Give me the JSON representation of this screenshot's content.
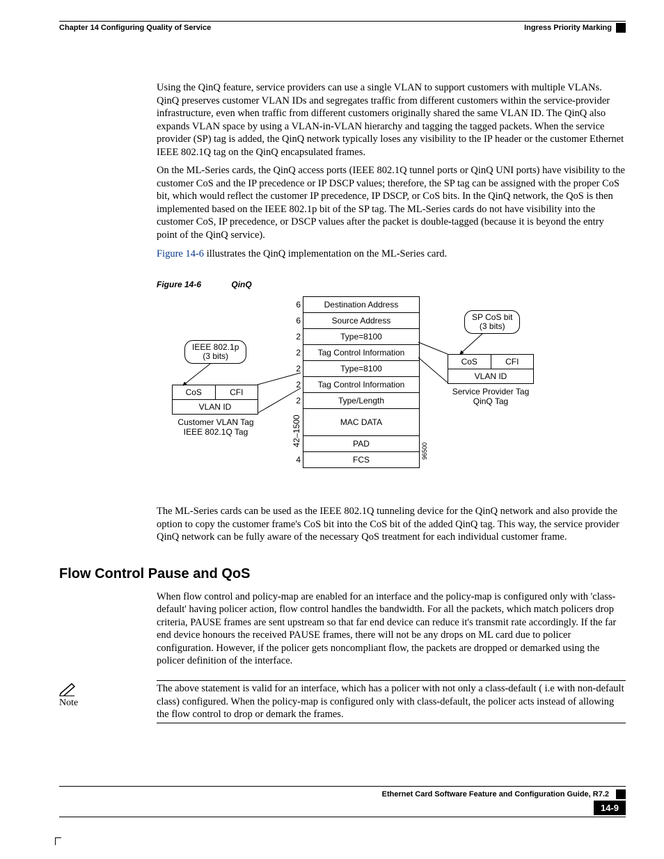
{
  "header": {
    "left": "Chapter 14 Configuring Quality of Service",
    "right": "Ingress Priority Marking"
  },
  "para1": "Using the QinQ feature, service providers can use a single VLAN to support customers with multiple VLANs. QinQ preserves customer VLAN IDs and segregates traffic from different customers within the service-provider infrastructure, even when traffic from different customers originally shared the same VLAN ID. The QinQ also expands VLAN space by using a VLAN-in-VLAN hierarchy and tagging the tagged packets. When the service provider (SP) tag is added, the QinQ network typically loses any visibility to the IP header or the customer Ethernet IEEE 802.1Q tag on the QinQ encapsulated frames.",
  "para2": "On the ML-Series cards, the QinQ access ports (IEEE 802.1Q tunnel ports or QinQ UNI ports) have visibility to the customer CoS and the IP precedence or IP DSCP values; therefore, the SP tag can be assigned with the proper CoS bit, which would reflect the customer IP precedence, IP DSCP, or CoS bits. In the QinQ network, the QoS is then implemented based on the IEEE 802.1p bit of the SP tag. The ML-Series cards do not have visibility into the customer CoS, IP precedence, or DSCP values after the packet is double-tagged (because it is beyond the entry point of the QinQ service).",
  "para3_link": "Figure 14-6",
  "para3_rest": " illustrates the QinQ implementation on the ML-Series card.",
  "fig": {
    "label": "Figure 14-6",
    "title": "QinQ"
  },
  "diagram": {
    "stack": [
      {
        "n": "6",
        "t": "Destination Address"
      },
      {
        "n": "6",
        "t": "Source Address"
      },
      {
        "n": "2",
        "t": "Type=8100"
      },
      {
        "n": "2",
        "t": "Tag Control Information"
      },
      {
        "n": "2",
        "t": "Type=8100"
      },
      {
        "n": "2",
        "t": "Tag Control Information"
      },
      {
        "n": "2",
        "t": "Type/Length"
      },
      {
        "n": "",
        "t": "MAC DATA"
      },
      {
        "n": "",
        "t": "PAD"
      },
      {
        "n": "4",
        "t": "FCS"
      }
    ],
    "range_label": "42–1500",
    "left_bubble": "IEEE 802.1p\n(3 bits)",
    "left_detail": {
      "c1": "CoS",
      "c2": "CFI",
      "full": "VLAN ID"
    },
    "left_caption": "Customer VLAN Tag\nIEEE 802.1Q Tag",
    "right_bubble": "SP CoS bit\n(3 bits)",
    "right_detail": {
      "c1": "CoS",
      "c2": "CFI",
      "full": "VLAN ID"
    },
    "right_caption": "Service Provider Tag\nQinQ Tag",
    "image_id": "96500"
  },
  "para4": "The ML-Series cards can be used as the IEEE 802.1Q tunneling device for the QinQ network and also provide the option to copy the customer frame's CoS bit into the CoS bit of the added QinQ tag. This way, the service provider QinQ network can be fully aware of the necessary QoS treatment for each individual customer frame.",
  "h2": "Flow Control Pause and QoS",
  "para5": "When flow control and policy-map are enabled for an interface and the policy-map is configured only with 'class-default' having policer action, flow control handles the bandwidth. For all the packets, which match policers drop criteria, PAUSE frames are sent upstream so that far end device can reduce it's transmit rate accordingly. If the far end device honours the received PAUSE frames, there will not be any drops on ML card due to policer configuration. However, if the policer gets noncompliant flow, the packets are dropped or demarked using the policer definition of the interface.",
  "note": {
    "label": "Note",
    "text": "The above statement is valid for an interface, which has a policer with not only a class-default ( i.e with non-default class) configured. When the policy-map is configured only with class-default, the policer acts instead of allowing the flow control to drop or demark the frames."
  },
  "footer": {
    "title": "Ethernet Card Software Feature and Configuration Guide, R7.2",
    "page": "14-9"
  }
}
